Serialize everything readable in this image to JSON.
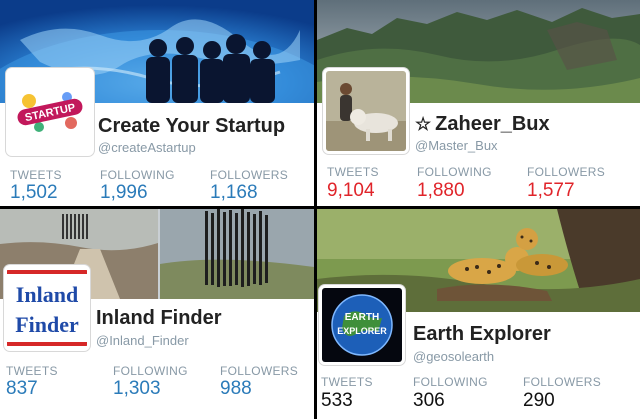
{
  "cards": [
    {
      "name": "Create Your Startup",
      "handle": "@createAstartup",
      "avatar_text": "STARTUP",
      "stats": [
        {
          "label": "TWEETS",
          "value": "1,502"
        },
        {
          "label": "FOLLOWING",
          "value": "1,996"
        },
        {
          "label": "FOLLOWERS",
          "value": "1,168"
        }
      ],
      "value_color": "#2b7bb9"
    },
    {
      "name": "Zaheer_Bux",
      "handle": "@Master_Bux",
      "name_icon": "star-icon",
      "stats": [
        {
          "label": "TWEETS",
          "value": "9,104"
        },
        {
          "label": "FOLLOWING",
          "value": "1,880"
        },
        {
          "label": "FOLLOWERS",
          "value": "1,577"
        }
      ],
      "value_color": "#e0242a"
    },
    {
      "name": "Inland Finder",
      "handle": "@Inland_Finder",
      "avatar_line1": "Inland",
      "avatar_line2": "Finder",
      "stats": [
        {
          "label": "TWEETS",
          "value": "837"
        },
        {
          "label": "FOLLOWING",
          "value": "1,303"
        },
        {
          "label": "FOLLOWERS",
          "value": "988"
        }
      ],
      "value_color": "#2b7bb9"
    },
    {
      "name": "Earth Explorer",
      "handle": "@geosolearth",
      "avatar_line1": "EARTH",
      "avatar_line2": "EXPLORER",
      "stats": [
        {
          "label": "TWEETS",
          "value": "533"
        },
        {
          "label": "FOLLOWING",
          "value": "306"
        },
        {
          "label": "FOLLOWERS",
          "value": "290"
        }
      ],
      "value_color": "#111111"
    }
  ]
}
